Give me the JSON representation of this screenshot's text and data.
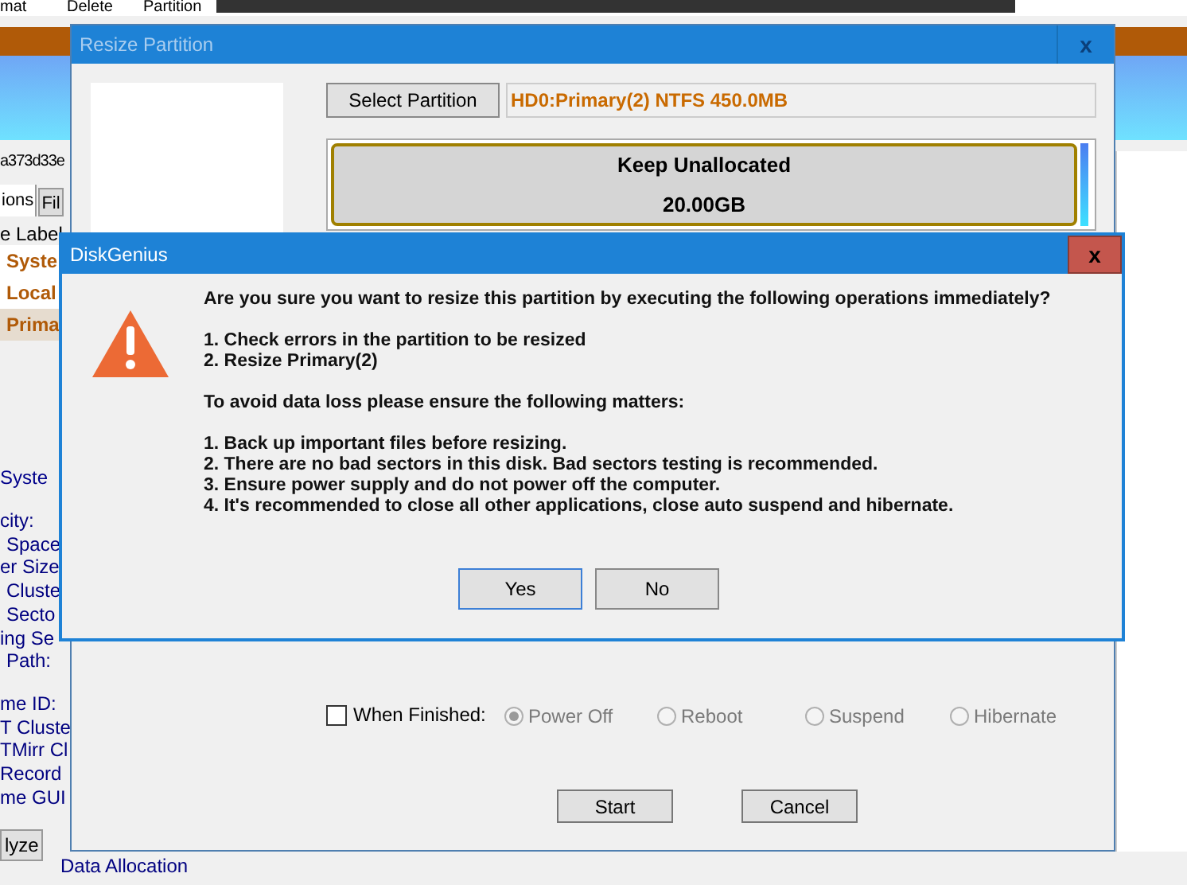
{
  "main_window": {
    "toolbar": [
      "mat",
      "Delete",
      "Partition"
    ],
    "disk_id": "a373d33e",
    "tabs": [
      {
        "label": "ions",
        "selected": true
      },
      {
        "label": "Fil",
        "selected": false
      }
    ],
    "column_header": "e Label",
    "partition_rows": [
      {
        "label": "Syste",
        "selected": false
      },
      {
        "label": "Local",
        "selected": false
      },
      {
        "label": "Prima",
        "selected": true
      }
    ],
    "section_title": "Syste",
    "properties": [
      "city:",
      "Space",
      "er Size",
      "Cluste",
      "Secto",
      "ing Se",
      "Path:"
    ],
    "properties_2": [
      "me ID:",
      "T Cluste",
      "TMirr Cl",
      "Record",
      "me GUI"
    ],
    "analyze_button": "lyze",
    "data_allocation": "Data Allocation"
  },
  "resize_window": {
    "title": "Resize Partition",
    "close": "x",
    "select_button": "Select Partition",
    "partition_field": "HD0:Primary(2) NTFS 450.0MB",
    "partition_bar": {
      "label": "Keep Unallocated",
      "size": "20.00GB"
    },
    "when_finished": {
      "label": "When Finished:",
      "checked": false
    },
    "finish_options": [
      {
        "label": "Power Off",
        "selected": true
      },
      {
        "label": "Reboot",
        "selected": false
      },
      {
        "label": "Suspend",
        "selected": false
      },
      {
        "label": "Hibernate",
        "selected": false
      }
    ],
    "buttons": [
      "Start",
      "Cancel"
    ]
  },
  "confirm_dialog": {
    "title": "DiskGenius",
    "close": "x",
    "question": "Are you sure you want to resize this partition by executing the following operations immediately?",
    "operations": [
      "1. Check errors in the partition to be resized",
      "2. Resize Primary(2)"
    ],
    "notice": "To avoid data loss please ensure the following matters:",
    "matters": [
      "1. Back up important files before resizing.",
      "2. There are no bad sectors in this disk. Bad sectors testing is recommended.",
      "3. Ensure power supply and do not power off the computer.",
      "4. It's recommended to close all other applications, close auto suspend and hibernate."
    ],
    "buttons": [
      "Yes",
      "No"
    ]
  }
}
